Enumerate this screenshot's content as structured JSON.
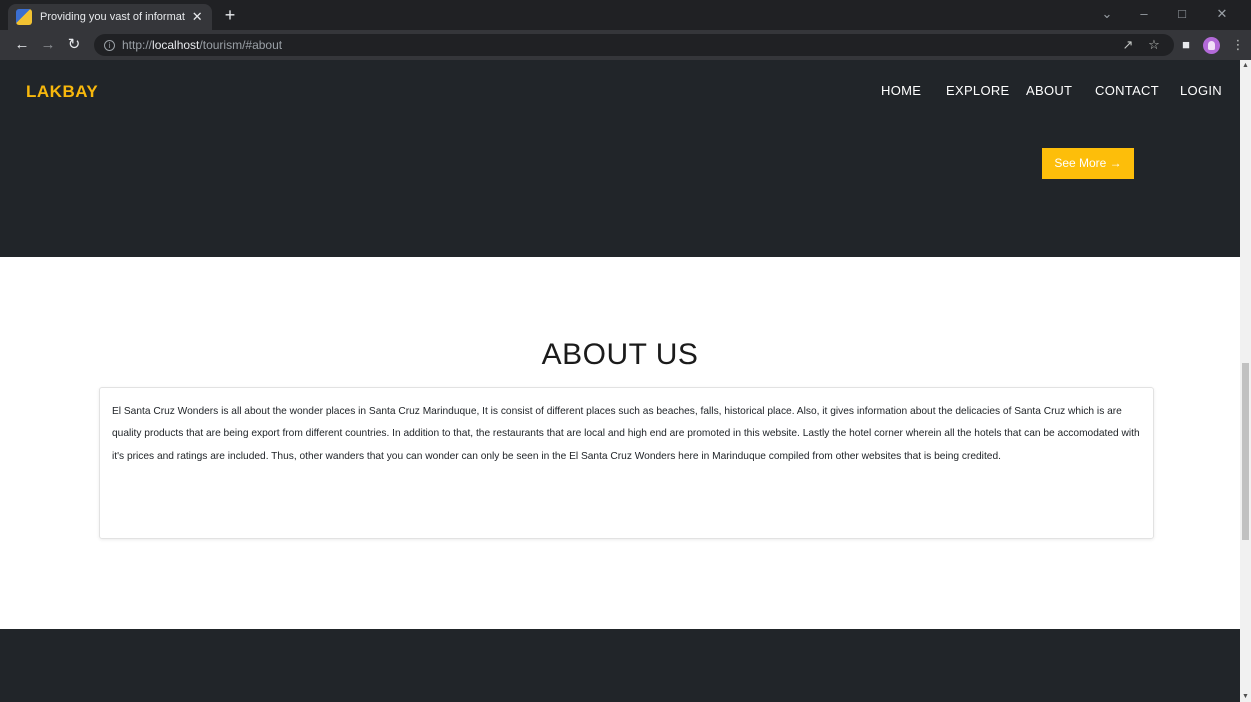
{
  "browser": {
    "tab_title": "Providing you vast of information",
    "tab_close": "✕",
    "new_tab": "+",
    "url_prefix": "http://",
    "url_host": "localhost",
    "url_path": "/tourism/#about",
    "icons": [
      "back-arrow-icon",
      "forward-arrow-icon",
      "reload-icon",
      "info-icon",
      "share-icon",
      "star-icon",
      "sidebar-icon",
      "profile-icon",
      "menu-icon"
    ]
  },
  "nav": {
    "brand": "LAKBAY",
    "items": [
      "HOME",
      "EXPLORE",
      "ABOUT",
      "CONTACT",
      "LOGIN"
    ]
  },
  "hero": {
    "button_label": "See More →"
  },
  "about": {
    "heading": "ABOUT US",
    "text": "El Santa Cruz Wonders is all about the wonder places in Santa Cruz Marinduque, It is consist of different places such as beaches, falls, historical place. Also, it gives information about the delicacies of Santa Cruz which is are  quality products that are being export from different countries. In addition to that, the restaurants that are local and high end are promoted in this website. Lastly the hotel corner wherein all the hotels that can be accomodated with it's prices and ratings are included. Thus, other wanders that you can wonder can only be seen in the El Santa Cruz Wonders here in Marinduque compiled from other websites that is being credited."
  },
  "colors": {
    "dark_bg": "#212529",
    "accent": "#fdbe0a",
    "brand": "#f8b80c"
  }
}
